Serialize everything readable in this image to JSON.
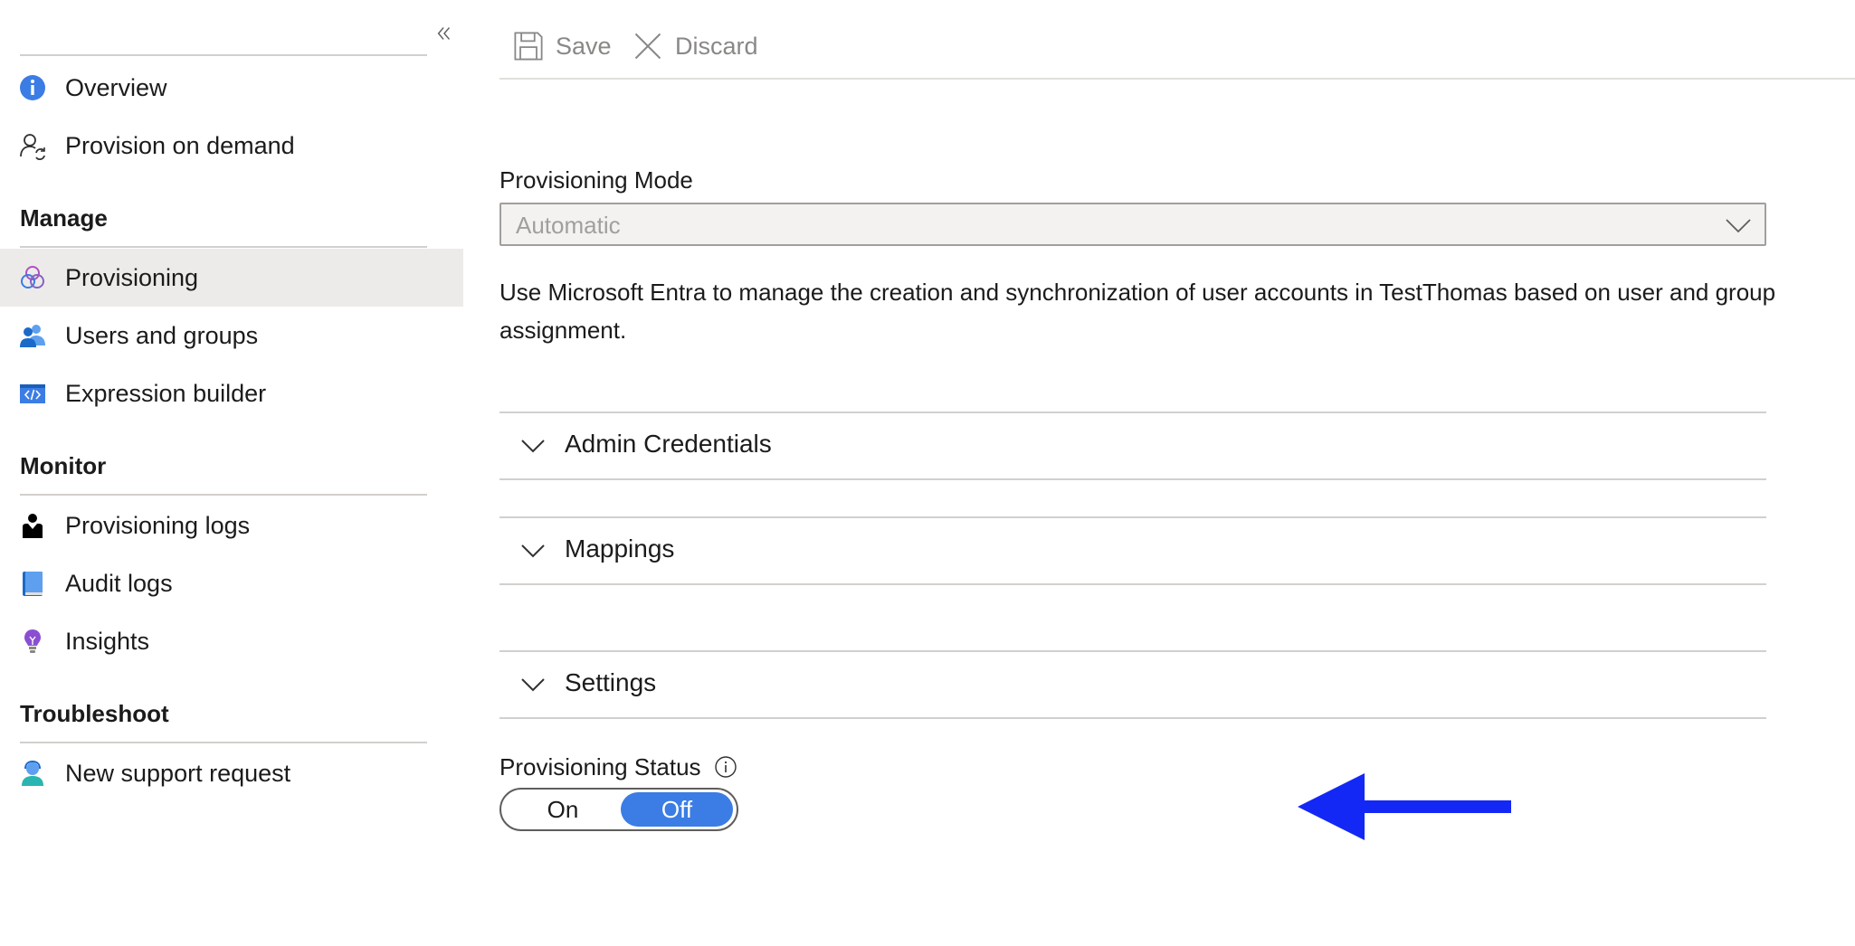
{
  "sidebar": {
    "collapse_icon": "double-chevron-left-icon",
    "top_items": [
      {
        "label": "Overview",
        "icon": "info-icon"
      },
      {
        "label": "Provision on demand",
        "icon": "user-sync-icon"
      }
    ],
    "sections": {
      "manage": {
        "title": "Manage",
        "items": [
          {
            "label": "Provisioning",
            "icon": "provisioning-icon",
            "active": true
          },
          {
            "label": "Users and groups",
            "icon": "users-icon"
          },
          {
            "label": "Expression builder",
            "icon": "code-icon"
          }
        ]
      },
      "monitor": {
        "title": "Monitor",
        "items": [
          {
            "label": "Provisioning logs",
            "icon": "person-log-icon"
          },
          {
            "label": "Audit logs",
            "icon": "book-icon"
          },
          {
            "label": "Insights",
            "icon": "lightbulb-icon"
          }
        ]
      },
      "troubleshoot": {
        "title": "Troubleshoot",
        "items": [
          {
            "label": "New support request",
            "icon": "support-person-icon"
          }
        ]
      }
    }
  },
  "toolbar": {
    "save_label": "Save",
    "discard_label": "Discard"
  },
  "form": {
    "mode_label": "Provisioning Mode",
    "mode_value": "Automatic",
    "description": "Use Microsoft Entra to manage the creation and synchronization of user accounts in TestThomas based on user and group assignment.",
    "accordions": [
      {
        "label": "Admin Credentials",
        "expanded": false
      },
      {
        "label": "Mappings",
        "expanded": false
      },
      {
        "label": "Settings",
        "expanded": false
      }
    ],
    "status_label": "Provisioning Status",
    "toggle": {
      "on_label": "On",
      "off_label": "Off",
      "selected": "Off"
    }
  },
  "colors": {
    "active_nav_bg": "#edebe9",
    "toggle_selected": "#3b7de4",
    "annotation_arrow": "#1428f5"
  }
}
